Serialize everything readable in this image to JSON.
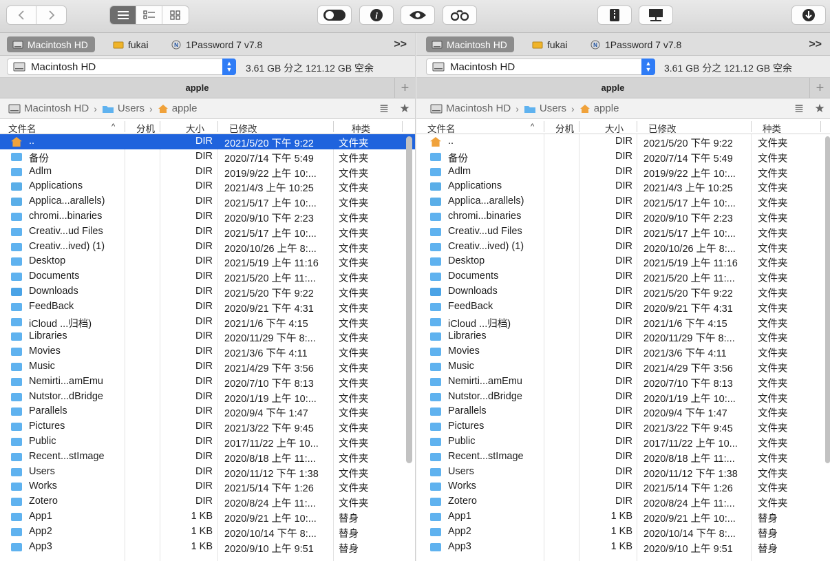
{
  "toolbar": {
    "back_icon": "chevron-left",
    "forward_icon": "chevron-right",
    "view_icons": [
      "list-view",
      "detail-view",
      "icon-view"
    ],
    "action_icons": [
      "toggle",
      "info",
      "eye",
      "binoculars",
      "archive",
      "network-share",
      "download"
    ]
  },
  "left": {
    "tabs": [
      "Macintosh HD",
      "fukai",
      "1Password 7 v7.8"
    ],
    "more": ">>",
    "volume": "Macintosh HD",
    "volume_info": "3.61 GB 分之 121.12 GB 空余",
    "path_title": "apple",
    "crumbs": [
      "Macintosh HD",
      "Users",
      "apple"
    ],
    "columns": [
      "文件名",
      "分机",
      "大小",
      "已修改",
      "种类"
    ]
  },
  "right": {
    "tabs": [
      "Macintosh HD",
      "fukai",
      "1Password 7 v7.8"
    ],
    "more": ">>",
    "volume": "Macintosh HD",
    "volume_info": "3.61 GB 分之 121.12 GB 空余",
    "path_title": "apple",
    "crumbs": [
      "Macintosh HD",
      "Users",
      "apple"
    ],
    "columns": [
      "文件名",
      "分机",
      "大小",
      "已修改",
      "种类"
    ]
  },
  "files": [
    {
      "name": "..",
      "size": "DIR",
      "modified": "2021/5/20 下午 9:22",
      "kind": "文件夹",
      "icon": "home"
    },
    {
      "name": "备份",
      "size": "DIR",
      "modified": "2020/7/14 下午 5:49",
      "kind": "文件夹",
      "icon": "folder"
    },
    {
      "name": "Adlm",
      "size": "DIR",
      "modified": "2019/9/22 上午 10:...",
      "kind": "文件夹",
      "icon": "folder"
    },
    {
      "name": "Applications",
      "size": "DIR",
      "modified": "2021/4/3 上午 10:25",
      "kind": "文件夹",
      "icon": "apps-folder"
    },
    {
      "name": "Applica...arallels)",
      "size": "DIR",
      "modified": "2021/5/17 上午 10:...",
      "kind": "文件夹",
      "icon": "apps-folder"
    },
    {
      "name": "chromi...binaries",
      "size": "DIR",
      "modified": "2020/9/10 下午 2:23",
      "kind": "文件夹",
      "icon": "folder"
    },
    {
      "name": "Creativ...ud Files",
      "size": "DIR",
      "modified": "2021/5/17 上午 10:...",
      "kind": "文件夹",
      "icon": "folder"
    },
    {
      "name": "Creativ...ived) (1)",
      "size": "DIR",
      "modified": "2020/10/26 上午 8:...",
      "kind": "文件夹",
      "icon": "folder"
    },
    {
      "name": "Desktop",
      "size": "DIR",
      "modified": "2021/5/19 上午 11:16",
      "kind": "文件夹",
      "icon": "folder"
    },
    {
      "name": "Documents",
      "size": "DIR",
      "modified": "2021/5/20 上午 11:...",
      "kind": "文件夹",
      "icon": "folder"
    },
    {
      "name": "Downloads",
      "size": "DIR",
      "modified": "2021/5/20 下午 9:22",
      "kind": "文件夹",
      "icon": "downloads-folder"
    },
    {
      "name": "FeedBack",
      "size": "DIR",
      "modified": "2020/9/21 下午 4:31",
      "kind": "文件夹",
      "icon": "folder"
    },
    {
      "name": "iCloud ...归档)",
      "size": "DIR",
      "modified": "2021/1/6 下午 4:15",
      "kind": "文件夹",
      "icon": "folder"
    },
    {
      "name": "Libraries",
      "size": "DIR",
      "modified": "2020/11/29 下午 8:...",
      "kind": "文件夹",
      "icon": "folder"
    },
    {
      "name": "Movies",
      "size": "DIR",
      "modified": "2021/3/6 下午 4:11",
      "kind": "文件夹",
      "icon": "folder"
    },
    {
      "name": "Music",
      "size": "DIR",
      "modified": "2021/4/29 下午 3:56",
      "kind": "文件夹",
      "icon": "folder"
    },
    {
      "name": "Nemirti...amEmu",
      "size": "DIR",
      "modified": "2020/7/10 下午 8:13",
      "kind": "文件夹",
      "icon": "folder"
    },
    {
      "name": "Nutstor...dBridge",
      "size": "DIR",
      "modified": "2020/1/19 上午 10:...",
      "kind": "文件夹",
      "icon": "folder"
    },
    {
      "name": "Parallels",
      "size": "DIR",
      "modified": "2020/9/4 下午 1:47",
      "kind": "文件夹",
      "icon": "folder"
    },
    {
      "name": "Pictures",
      "size": "DIR",
      "modified": "2021/3/22 下午 9:45",
      "kind": "文件夹",
      "icon": "folder"
    },
    {
      "name": "Public",
      "size": "DIR",
      "modified": "2017/11/22 上午 10...",
      "kind": "文件夹",
      "icon": "folder"
    },
    {
      "name": "Recent...stImage",
      "size": "DIR",
      "modified": "2020/8/18 上午 11:...",
      "kind": "文件夹",
      "icon": "folder"
    },
    {
      "name": "Users",
      "size": "DIR",
      "modified": "2020/11/12 下午 1:38",
      "kind": "文件夹",
      "icon": "folder"
    },
    {
      "name": "Works",
      "size": "DIR",
      "modified": "2021/5/14 下午 1:26",
      "kind": "文件夹",
      "icon": "folder"
    },
    {
      "name": "Zotero",
      "size": "DIR",
      "modified": "2020/8/24 上午 11:...",
      "kind": "文件夹",
      "icon": "folder"
    },
    {
      "name": "App1",
      "size": "1 KB",
      "modified": "2020/9/21 上午 10:...",
      "kind": "替身",
      "icon": "alias"
    },
    {
      "name": "App2",
      "size": "1 KB",
      "modified": "2020/10/14 下午 8:...",
      "kind": "替身",
      "icon": "alias"
    },
    {
      "name": "App3",
      "size": "1 KB",
      "modified": "2020/9/10 上午 9:51",
      "kind": "替身",
      "icon": "alias"
    }
  ],
  "colors": {
    "selection": "#1f63dd",
    "folder": "#5fb2ef",
    "accent": "#2f7cf6"
  }
}
